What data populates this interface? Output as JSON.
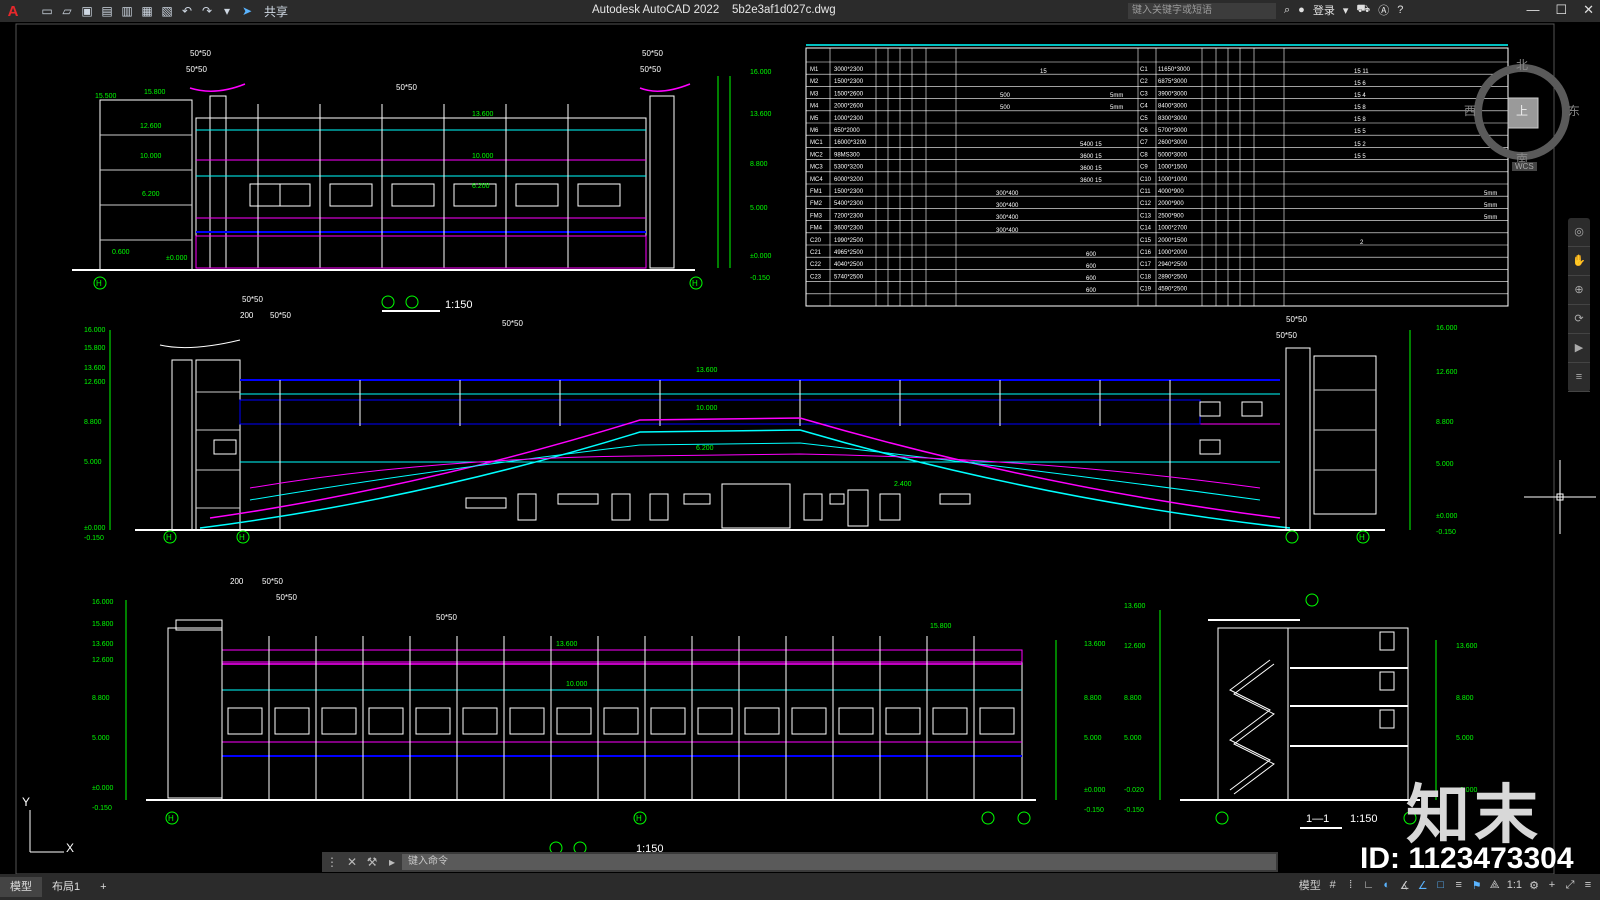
{
  "app": {
    "title": "Autodesk AutoCAD 2022",
    "filename": "5b2e3af1d027c.dwg",
    "logo": "A",
    "share_label": "共享",
    "search_placeholder": "键入关键字或短语",
    "login_label": "登录",
    "quick_access_icons": [
      "new-icon",
      "open-icon",
      "save-icon",
      "saveas-icon",
      "open-web-icon",
      "print-icon",
      "plot-icon",
      "undo-icon",
      "redo-icon",
      "workspace-icon"
    ],
    "window_controls": [
      "minimize-icon",
      "maximize-icon",
      "close-icon"
    ]
  },
  "viewcube": {
    "north": "北",
    "south": "南",
    "east": "东",
    "west": "西",
    "top": "上",
    "wcs": "WCS"
  },
  "ucs": {
    "x": "X",
    "y": "Y"
  },
  "command": {
    "placeholder": "键入命令"
  },
  "layout_tabs": [
    {
      "label": "模型",
      "active": true
    },
    {
      "label": "布局1",
      "active": false
    }
  ],
  "add_tab": "+",
  "status": {
    "model_label": "模型",
    "scale_label": "1:1",
    "icons": [
      "grid-icon",
      "snap-icon",
      "ortho-icon",
      "polar-icon",
      "isodraft-icon",
      "osnap-track-icon",
      "osnap-icon",
      "lineweight-icon",
      "transparency-icon",
      "annotation-icon",
      "workspace-gear-icon",
      "plus-icon",
      "fullscreen-icon",
      "customize-icon"
    ]
  },
  "drawing": {
    "north_elev_title_axes": [
      "⑧",
      "⑪"
    ],
    "scale_1_150": "1:150",
    "scale_1_150_b": "1:150",
    "section_label": "1—1",
    "section_scale": "1:150",
    "dim_5050": "50*50",
    "dim_200": "200",
    "axis_h": "H",
    "axis_1": "1",
    "elev_labels": [
      "15.500",
      "15.800",
      "12.600",
      "10.000",
      "6.200",
      "0.600",
      "±0.000",
      "-0.020",
      "-0.150",
      "16.000",
      "13.600",
      "8.800",
      "5.000",
      "2.400"
    ]
  },
  "door_schedule": {
    "rows_left": [
      [
        "M1",
        "3000*2300"
      ],
      [
        "M2",
        "1500*2300"
      ],
      [
        "M3",
        "1500*2600"
      ],
      [
        "M4",
        "2000*2600"
      ],
      [
        "M5",
        "1000*2300"
      ],
      [
        "M6",
        "650*2000"
      ],
      [
        "MC1",
        "16000*3200"
      ],
      [
        "MC2",
        "98MS300"
      ],
      [
        "MC3",
        "5300*3200"
      ],
      [
        "MC4",
        "6000*3200"
      ],
      [
        "FM1",
        "1500*2300"
      ],
      [
        "FM2",
        "5400*2300"
      ],
      [
        "FM3",
        "7200*2300"
      ],
      [
        "FM4",
        "3600*2300"
      ],
      [
        "C20",
        "1990*2500"
      ],
      [
        "C21",
        "4965*2500"
      ],
      [
        "C22",
        "4040*2500"
      ],
      [
        "C23",
        "5740*2500"
      ]
    ],
    "rows_right": [
      [
        "C1",
        "11650*3000"
      ],
      [
        "C2",
        "6875*3000"
      ],
      [
        "C3",
        "3900*3000"
      ],
      [
        "C4",
        "8400*3000"
      ],
      [
        "C5",
        "8300*3000"
      ],
      [
        "C6",
        "5700*3000"
      ],
      [
        "C7",
        "2600*3000"
      ],
      [
        "C8",
        "5000*3000"
      ],
      [
        "C9",
        "1000*1500"
      ],
      [
        "C10",
        "1000*1000"
      ],
      [
        "C11",
        "4000*900"
      ],
      [
        "C12",
        "2000*900"
      ],
      [
        "C13",
        "2500*900"
      ],
      [
        "C14",
        "1000*2700"
      ],
      [
        "C15",
        "2000*1500"
      ],
      [
        "C16",
        "1000*2000"
      ],
      [
        "C17",
        "2940*2500"
      ],
      [
        "C18",
        "2890*2500"
      ],
      [
        "C19",
        "4590*2500"
      ]
    ],
    "notes": [
      "15",
      "500",
      "500",
      "5mm",
      "5mm",
      "5400 15",
      "3600 15",
      "3600 15",
      "3600 15",
      "300*400",
      "300*400",
      "300*400",
      "300*400",
      "600",
      "600",
      "600",
      "600",
      "15 11",
      "15 6",
      "15 4",
      "15 8",
      "15 8",
      "15 5",
      "15 2",
      "15 5",
      "5mm",
      "5mm",
      "5mm",
      "2"
    ]
  },
  "watermark": {
    "id_text": "ID: 1123473304",
    "logo_text": "知末"
  }
}
